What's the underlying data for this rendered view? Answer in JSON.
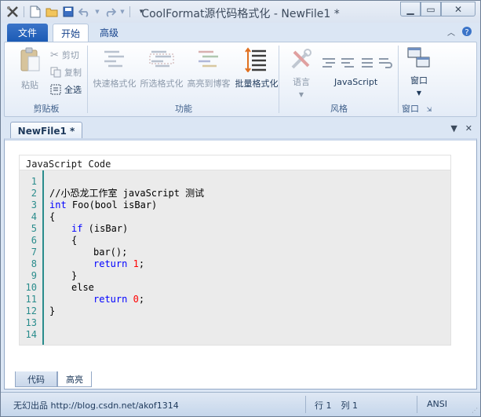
{
  "window": {
    "title": "CoolFormat源代码格式化 - NewFile1 *"
  },
  "quick_access": {
    "icons": [
      "app-icon",
      "new-file-icon",
      "open-folder-icon",
      "save-icon",
      "undo-icon",
      "redo-icon",
      "customize-icon"
    ]
  },
  "ribbon_tabs": {
    "file": "文件",
    "home": "开始",
    "advanced": "高级"
  },
  "clipboard_group": {
    "label": "剪贴板",
    "paste": "粘贴",
    "cut": "剪切",
    "copy": "复制",
    "select_all": "全选"
  },
  "function_group": {
    "label": "功能",
    "quick_format": "快速格式化",
    "selection_format": "所选格式化",
    "highlight_to_blog": "高亮到博客",
    "batch_format": "批量格式化"
  },
  "style_group": {
    "label": "风格",
    "language": "语言",
    "current_language": "JavaScript"
  },
  "window_group": {
    "label": "窗口",
    "window": "窗口"
  },
  "document": {
    "tab_name": "NewFile1 *",
    "header": "JavaScript Code"
  },
  "code": {
    "lines": [
      {
        "n": "1"
      },
      {
        "n": "2"
      },
      {
        "n": "3"
      },
      {
        "n": "4"
      },
      {
        "n": "5"
      },
      {
        "n": "6"
      },
      {
        "n": "7"
      },
      {
        "n": "8"
      },
      {
        "n": "9"
      },
      {
        "n": "10"
      },
      {
        "n": "11"
      },
      {
        "n": "12"
      },
      {
        "n": "13"
      },
      {
        "n": "14"
      }
    ],
    "comment": "//小恐龙工作室 javaScript 测试",
    "kw_int": "int",
    "func_sig": " Foo(bool isBar)",
    "brace_open": "{",
    "kw_if": "if",
    "if_cond": " (isBar)",
    "inner_open": "{",
    "call": "bar();",
    "kw_return": "return",
    "ret1": "1",
    "semi": ";",
    "inner_close": "}",
    "kw_else": "else",
    "ret0": "0",
    "brace_close": "}"
  },
  "bottom_tabs": {
    "code": "代码",
    "highlight": "高亮"
  },
  "status": {
    "credit": "无幻出品 http://blog.csdn.net/akof1314",
    "row": "行 1",
    "col": "列 1",
    "encoding": "ANSI"
  },
  "colors": {
    "accent": "#1c5bb5",
    "keyword": "#0000ff",
    "comment": "#008000",
    "number": "#ff0000",
    "gutter": "#2a8c8c"
  }
}
